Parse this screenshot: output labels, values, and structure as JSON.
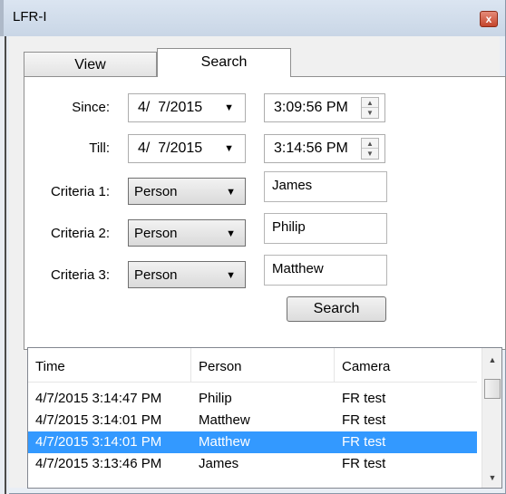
{
  "window": {
    "title": "LFR-I",
    "close_glyph": "x"
  },
  "tabs": [
    {
      "label": "View",
      "selected": false
    },
    {
      "label": "Search",
      "selected": true
    }
  ],
  "search_form": {
    "since": {
      "label": "Since:",
      "date": "4/  7/2015",
      "time": "3:09:56 PM"
    },
    "till": {
      "label": "Till:",
      "date": "4/  7/2015",
      "time": "3:14:56 PM"
    },
    "criteria": [
      {
        "label": "Criteria 1:",
        "type": "Person",
        "value": "James"
      },
      {
        "label": "Criteria 2:",
        "type": "Person",
        "value": "Philip"
      },
      {
        "label": "Criteria 3:",
        "type": "Person",
        "value": "Matthew"
      }
    ],
    "search_button": "Search"
  },
  "results": {
    "columns": [
      "Time",
      "Person",
      "Camera"
    ],
    "rows": [
      {
        "time": "4/7/2015 3:14:47 PM",
        "person": "Philip",
        "camera": "FR test",
        "selected": false
      },
      {
        "time": "4/7/2015 3:14:01 PM",
        "person": "Matthew",
        "camera": "FR test",
        "selected": false
      },
      {
        "time": "4/7/2015 3:14:01 PM",
        "person": "Matthew",
        "camera": "FR test",
        "selected": true
      },
      {
        "time": "4/7/2015 3:13:46 PM",
        "person": "James",
        "camera": "FR test",
        "selected": false
      }
    ]
  },
  "colors": {
    "selection": "#3399ff",
    "close_button": "#c4452c"
  },
  "icons": {
    "dropdown": "chevron-down-icon",
    "spin_up": "spin-up-icon",
    "spin_down": "spin-down-icon",
    "scroll_up": "scroll-up-icon",
    "scroll_down": "scroll-down-icon",
    "close": "close-icon"
  }
}
